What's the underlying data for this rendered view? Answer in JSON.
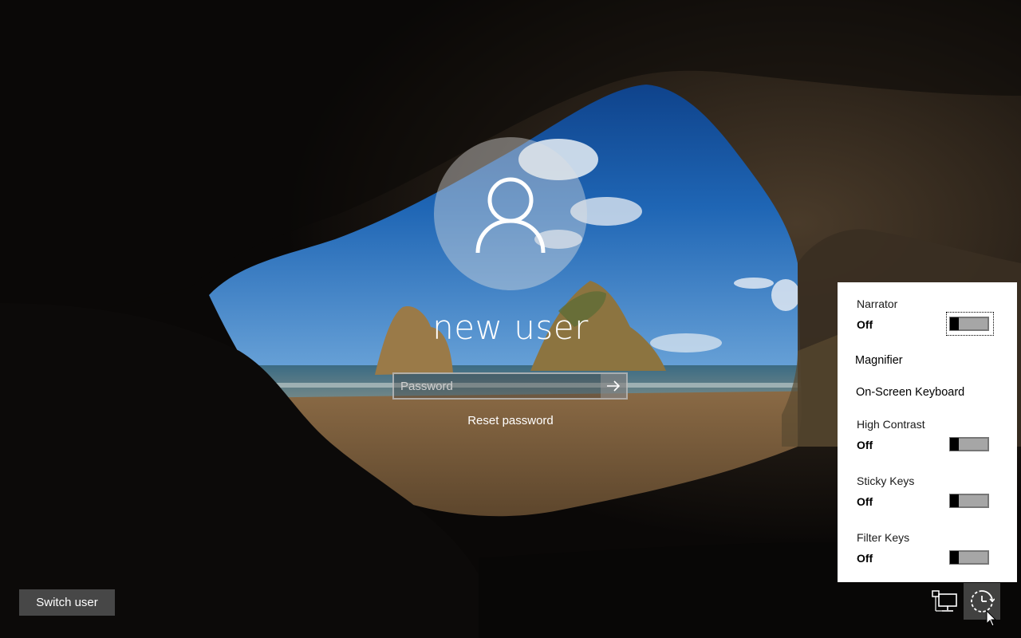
{
  "login": {
    "username": "new user",
    "password_placeholder": "Password",
    "reset_password": "Reset password"
  },
  "switch_user": "Switch user",
  "ease_of_access": {
    "items": [
      {
        "label": "Narrator",
        "state": "Off",
        "toggle": true
      },
      {
        "label": "Magnifier",
        "toggle": false
      },
      {
        "label": "On-Screen Keyboard",
        "toggle": false
      },
      {
        "label": "High Contrast",
        "state": "Off",
        "toggle": true
      },
      {
        "label": "Sticky Keys",
        "state": "Off",
        "toggle": true
      },
      {
        "label": "Filter Keys",
        "state": "Off",
        "toggle": true
      }
    ]
  },
  "tray": {
    "network_icon": "network-icon",
    "ease_icon": "ease-of-access-icon"
  },
  "colors": {
    "panel_bg": "#ffffff",
    "toggle_track": "#a6a6a6",
    "switch_user_bg": "#505050"
  }
}
